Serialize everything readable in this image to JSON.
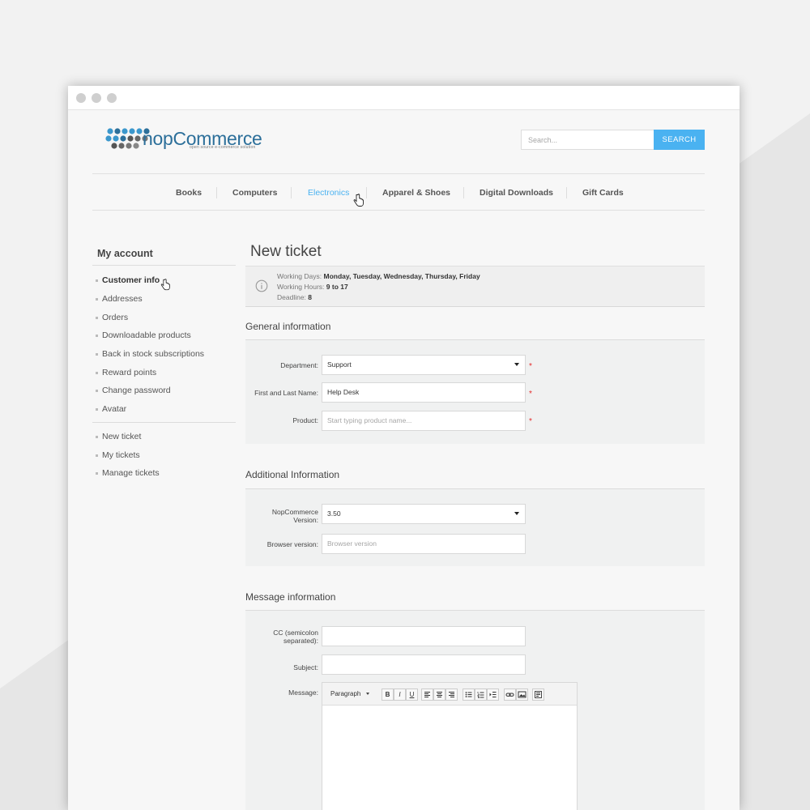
{
  "header": {
    "logo_text": "nopCommerce",
    "logo_sub": "open source e-commerce solution",
    "search_placeholder": "Search...",
    "search_button": "SEARCH"
  },
  "nav": {
    "items": [
      "Books",
      "Computers",
      "Electronics",
      "Apparel & Shoes",
      "Digital Downloads",
      "Gift Cards"
    ],
    "active": "Electronics"
  },
  "sidebar": {
    "title": "My account",
    "items": [
      "Customer info",
      "Addresses",
      "Orders",
      "Downloadable products",
      "Back in stock subscriptions",
      "Reward points",
      "Change password",
      "Avatar"
    ],
    "items2": [
      "New ticket",
      "My tickets",
      "Manage tickets"
    ],
    "active": "Customer info"
  },
  "main": {
    "title": "New ticket",
    "info": {
      "working_days_label": "Working Days:",
      "working_days": "Monday, Tuesday, Wednesday, Thursday, Friday",
      "working_hours_label": "Working Hours:",
      "working_hours": "9 to 17",
      "deadline_label": "Deadline:",
      "deadline": "8"
    },
    "general": {
      "title": "General information",
      "department_label": "Department:",
      "department_value": "Support",
      "name_label": "First and Last Name:",
      "name_value": "Help Desk",
      "product_label": "Product:",
      "product_placeholder": "Start typing product name..."
    },
    "additional": {
      "title": "Additional Information",
      "version_label_1": "NopCommerce",
      "version_label_2": "Version:",
      "version_value": "3.50",
      "browser_label": "Browser version:",
      "browser_placeholder": "Browser version"
    },
    "message": {
      "title": "Message information",
      "cc_label_1": "CC (semicolon",
      "cc_label_2": "separated):",
      "subject_label": "Subject:",
      "message_label": "Message:",
      "editor_format": "Paragraph",
      "required_mark": "*",
      "toolbar": [
        "B",
        "I",
        "U"
      ]
    }
  },
  "colors": {
    "accent": "#4ab2f1",
    "required": "#e42b2b",
    "logo": "#2c6f9a"
  }
}
